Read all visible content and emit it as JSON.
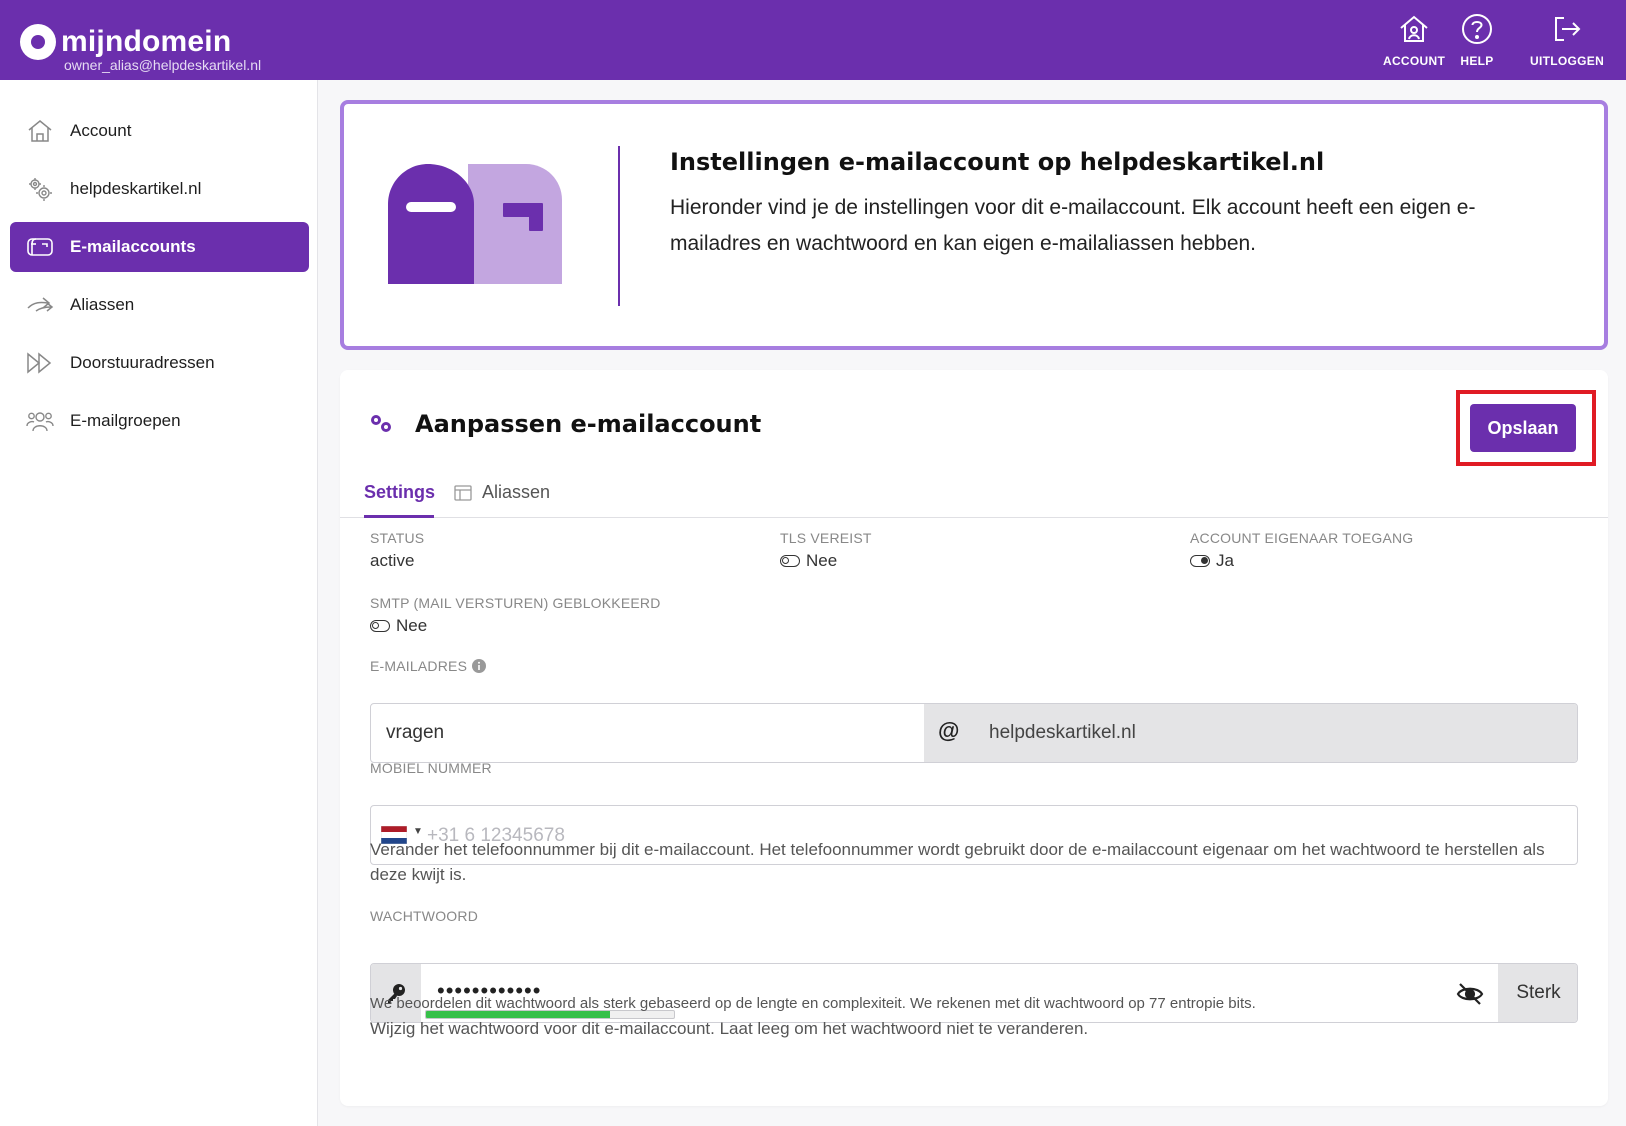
{
  "brand": {
    "name": "mijndomein",
    "user": "owner_alias@helpdeskartikel.nl",
    "accent": "#6b2fad"
  },
  "topnav": {
    "account": "ACCOUNT",
    "help": "HELP",
    "logout": "UITLOGGEN"
  },
  "sidebar": {
    "items": [
      {
        "label": "Account",
        "icon": "home-icon"
      },
      {
        "label": "helpdeskartikel.nl",
        "icon": "gears-icon"
      },
      {
        "label": "E-mailaccounts",
        "icon": "mailbox-icon",
        "active": true
      },
      {
        "label": "Aliassen",
        "icon": "arrows-right-icon"
      },
      {
        "label": "Doorstuuradressen",
        "icon": "forward-icon"
      },
      {
        "label": "E-mailgroepen",
        "icon": "users-icon"
      }
    ]
  },
  "banner": {
    "title": "Instellingen e-mailaccount op helpdeskartikel.nl",
    "text": "Hieronder vind je de instellingen voor dit e-mailaccount. Elk account heeft een eigen e-mailadres en wachtwoord en kan eigen e-mailaliassen hebben."
  },
  "card": {
    "title": "Aanpassen e-mailaccount",
    "save_label": "Opslaan",
    "tabs": [
      {
        "label": "Settings",
        "active": true
      },
      {
        "label": "Aliassen"
      }
    ],
    "fields": {
      "status": {
        "label": "STATUS",
        "value": "active"
      },
      "tls": {
        "label": "TLS VEREIST",
        "value": "Nee",
        "on": false
      },
      "owner_access": {
        "label": "ACCOUNT EIGENAAR TOEGANG",
        "value": "Ja",
        "on": true
      },
      "smtp": {
        "label": "SMTP (MAIL VERSTUREN) GEBLOKKEERD",
        "value": "Nee",
        "on": false
      },
      "email": {
        "label": "E-MAILADRES",
        "local": "vragen",
        "at": "@",
        "domain": "helpdeskartikel.nl"
      },
      "mobile": {
        "label": "MOBIEL NUMMER",
        "placeholder": "+31 6 12345678",
        "help": "Verander het telefoonnummer bij dit e-mailaccount. Het telefoonnummer wordt gebruikt door de e-mailaccount eigenaar om het wachtwoord te herstellen als deze kwijt is."
      },
      "password": {
        "label": "WACHTWOORD",
        "masked": "••••••••••••",
        "strength": "Sterk",
        "strength_fraction": 0.74,
        "strength_color": "#37c04a",
        "note": "We beoordelen dit wachtwoord als sterk gebaseerd op de lengte en complexiteit. We rekenen met dit wachtwoord op 77 entropie bits.",
        "help": "Wijzig het wachtwoord voor dit e-mailaccount. Laat leeg om het wachtwoord niet te veranderen."
      }
    }
  }
}
